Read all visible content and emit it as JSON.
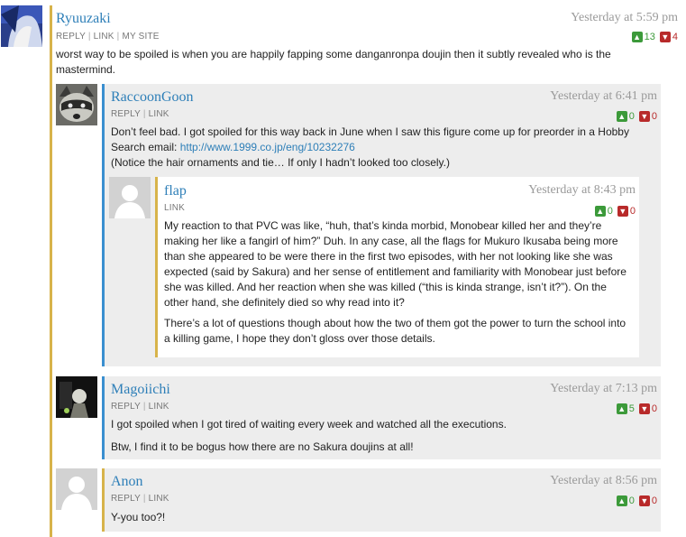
{
  "comments": [
    {
      "name": "Ryuuzaki",
      "time": "Yesterday at 5:59 pm",
      "links": [
        "REPLY",
        "LINK",
        "MY SITE"
      ],
      "up": "13",
      "down": "4",
      "paragraphs": [
        "worst way to be spoiled is when you are happily fapping some danganronpa doujin then it subtly revealed who is the mastermind."
      ]
    },
    {
      "name": "RaccoonGoon",
      "time": "Yesterday at 6:41 pm",
      "links": [
        "REPLY",
        "LINK"
      ],
      "up": "0",
      "down": "0",
      "text_before_link": "Don’t feel bad. I got spoiled for this way back in June when I saw this figure come up for preorder in a Hobby Search email: ",
      "url": "http://www.1999.co.jp/eng/10232276",
      "text_after": "(Notice the hair ornaments and tie… If only I hadn’t looked too closely.)"
    },
    {
      "name": "flap",
      "time": "Yesterday at 8:43 pm",
      "links": [
        "LINK"
      ],
      "up": "0",
      "down": "0",
      "paragraphs": [
        "My reaction to that PVC was like, “huh, that’s kinda morbid, Monobear killed her and they’re making her like a fangirl of him?” Duh. In any case, all the flags for Mukuro Ikusaba being more than she appeared to be were there in the first two episodes, with her not looking like she was expected (said by Sakura) and her sense of entitlement and familiarity with Monobear just before she was killed. And her reaction when she was killed (“this is kinda strange, isn’t it?”). On the other hand, she definitely died so why read into it?",
        "There’s a lot of questions though about how the two of them got the power to turn the school into a killing game, I hope they don’t gloss over those details."
      ]
    },
    {
      "name": "Magoiichi",
      "time": "Yesterday at 7:13 pm",
      "links": [
        "REPLY",
        "LINK"
      ],
      "up": "5",
      "down": "0",
      "paragraphs": [
        "I got spoiled when I got tired of waiting every week and watched all the executions.",
        "Btw, I find it to be bogus how there are no Sakura doujins at all!"
      ]
    },
    {
      "name": "Anon",
      "time": "Yesterday at 8:56 pm",
      "links": [
        "REPLY",
        "LINK"
      ],
      "up": "0",
      "down": "0",
      "paragraphs": [
        "Y-you too?!"
      ]
    }
  ],
  "colors": {
    "gold_bar": "#d7b34a",
    "blue_bar": "#3a8fd0",
    "name_blue": "#2e7fb8",
    "vote_up": "#3c9a3a",
    "vote_down": "#b82a2a",
    "box_bg": "#ededed"
  },
  "icons": {
    "up": "thumbs-up-icon",
    "down": "thumbs-down-icon",
    "default_avatar": "default-user-avatar"
  }
}
